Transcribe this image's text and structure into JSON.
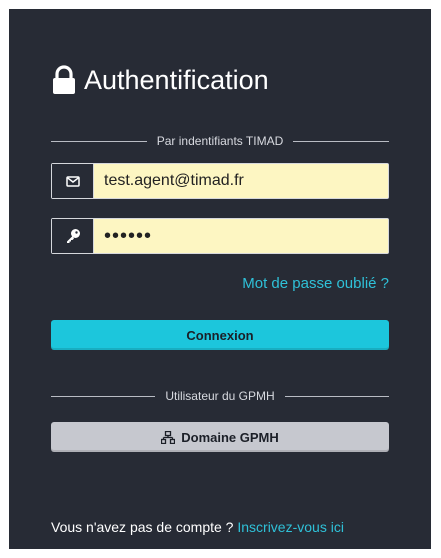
{
  "header": {
    "title": "Authentification",
    "icon": "lock-icon"
  },
  "timad_section": {
    "label": "Par indentifiants TIMAD"
  },
  "email_field": {
    "value": "test.agent@timad.fr",
    "icon": "envelope-icon"
  },
  "password_field": {
    "value": "••••••",
    "icon": "key-icon"
  },
  "forgot_password": {
    "label": "Mot de passe oublié ?"
  },
  "connect_button": {
    "label": "Connexion"
  },
  "gpmh_section": {
    "label": "Utilisateur du GPMH"
  },
  "gpmh_button": {
    "label": "Domaine GPMH",
    "icon": "network-icon"
  },
  "signup": {
    "text": "Vous n'avez pas de compte ? ",
    "link": "Inscrivez-vous ici"
  },
  "colors": {
    "panel_bg": "#272b35",
    "accent": "#1cc6dc",
    "input_bg": "#fdf6c2",
    "secondary_button": "#c6c8cf"
  }
}
